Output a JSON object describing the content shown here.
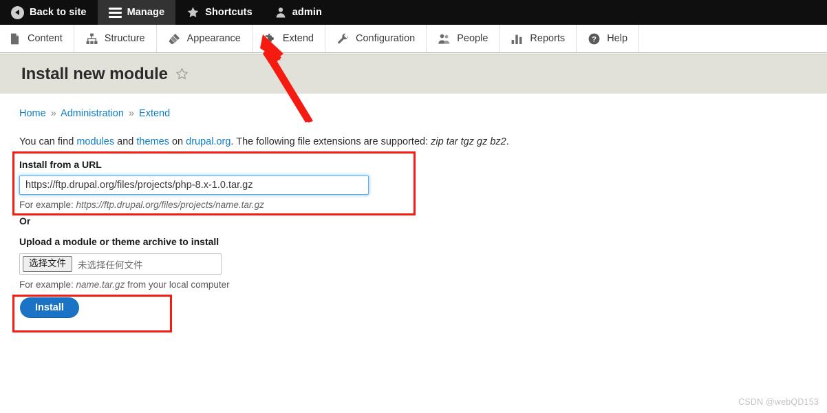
{
  "admin_bar": {
    "items": [
      {
        "label": "Back to site",
        "icon": "back-arrow-icon",
        "active": false
      },
      {
        "label": "Manage",
        "icon": "hamburger-icon",
        "active": true
      },
      {
        "label": "Shortcuts",
        "icon": "star-icon",
        "active": false
      },
      {
        "label": "admin",
        "icon": "user-icon",
        "active": false
      }
    ]
  },
  "menu_bar": {
    "items": [
      {
        "label": "Content",
        "icon": "document-icon"
      },
      {
        "label": "Structure",
        "icon": "sitemap-icon"
      },
      {
        "label": "Appearance",
        "icon": "paintbrush-icon"
      },
      {
        "label": "Extend",
        "icon": "puzzle-piece-icon"
      },
      {
        "label": "Configuration",
        "icon": "wrench-icon"
      },
      {
        "label": "People",
        "icon": "people-icon"
      },
      {
        "label": "Reports",
        "icon": "bar-chart-icon"
      },
      {
        "label": "Help",
        "icon": "question-mark-icon"
      }
    ]
  },
  "page": {
    "title": "Install new module",
    "favorite_icon": "star-outline-icon"
  },
  "breadcrumb": {
    "items": [
      "Home",
      "Administration",
      "Extend"
    ],
    "separator": "»"
  },
  "intro": {
    "prefix": "You can find ",
    "link_modules": "modules",
    "mid1": " and ",
    "link_themes": "themes",
    "mid2": " on ",
    "link_site": "drupal.org",
    "mid3": ". The following file extensions are supported: ",
    "extensions": "zip tar tgz gz bz2",
    "suffix": "."
  },
  "url_field": {
    "label": "Install from a URL",
    "value": "https://ftp.drupal.org/files/projects/php-8.x-1.0.tar.gz",
    "placeholder": "",
    "description_prefix": "For example: ",
    "description_example": "https://ftp.drupal.org/files/projects/name.tar.gz"
  },
  "or_label": "Or",
  "upload_field": {
    "label": "Upload a module or theme archive to install",
    "button_label": "选择文件",
    "no_file_text": "未选择任何文件",
    "description_prefix": "For example: ",
    "description_example": "name.tar.gz",
    "description_suffix": " from your local computer"
  },
  "actions": {
    "install_label": "Install"
  },
  "annotations": {
    "arrow_color": "#f51b10",
    "box_color": "#f51b10",
    "arrow_target": "Extend"
  },
  "watermark": "CSDN @webQD153"
}
